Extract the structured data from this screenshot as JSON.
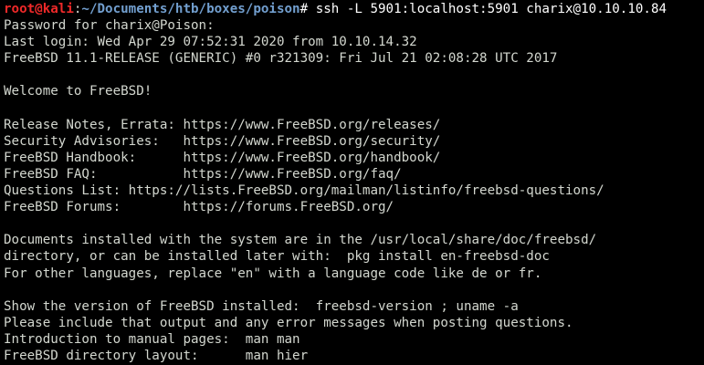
{
  "prompt": {
    "user_host": "root@kali",
    "separator": ":",
    "path": "~/Documents/htb/boxes/poison",
    "symbol": "# ",
    "command": "ssh -L 5901:localhost:5901 charix@10.10.10.84"
  },
  "output_lines": [
    "Password for charix@Poison:",
    "Last login: Wed Apr 29 07:52:31 2020 from 10.10.14.32",
    "FreeBSD 11.1-RELEASE (GENERIC) #0 r321309: Fri Jul 21 02:08:28 UTC 2017",
    "",
    "Welcome to FreeBSD!",
    "",
    "Release Notes, Errata: https://www.FreeBSD.org/releases/",
    "Security Advisories:   https://www.FreeBSD.org/security/",
    "FreeBSD Handbook:      https://www.FreeBSD.org/handbook/",
    "FreeBSD FAQ:           https://www.FreeBSD.org/faq/",
    "Questions List: https://lists.FreeBSD.org/mailman/listinfo/freebsd-questions/",
    "FreeBSD Forums:        https://forums.FreeBSD.org/",
    "",
    "Documents installed with the system are in the /usr/local/share/doc/freebsd/",
    "directory, or can be installed later with:  pkg install en-freebsd-doc",
    "For other languages, replace \"en\" with a language code like de or fr.",
    "",
    "Show the version of FreeBSD installed:  freebsd-version ; uname -a",
    "Please include that output and any error messages when posting questions.",
    "Introduction to manual pages:  man man",
    "FreeBSD directory layout:      man hier"
  ]
}
